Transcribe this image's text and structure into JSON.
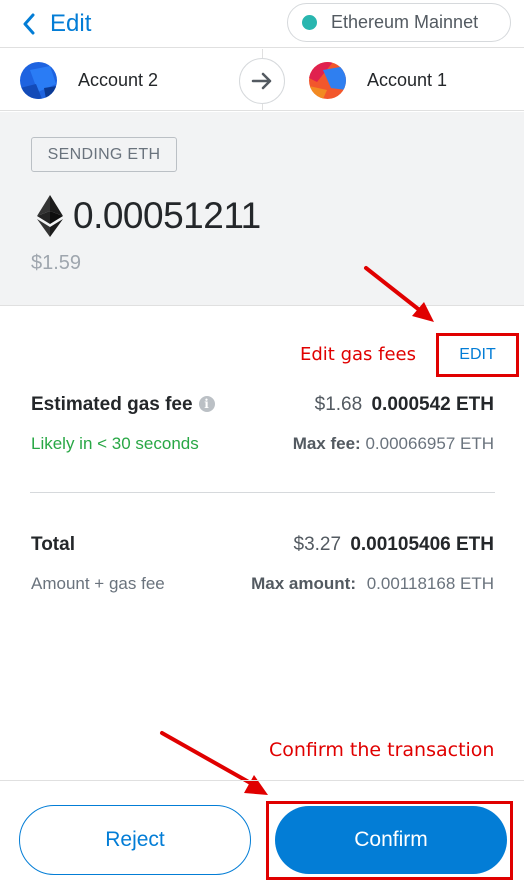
{
  "header": {
    "back_label": "Edit",
    "network": "Ethereum Mainnet",
    "network_color": "#29b6af"
  },
  "accounts": {
    "from": "Account 2",
    "to": "Account 1"
  },
  "sending": {
    "badge": "SENDING ETH",
    "amount": "0.00051211",
    "fiat": "$1.59"
  },
  "gas": {
    "annotation": "Edit gas fees",
    "edit_label": "EDIT",
    "label": "Estimated gas fee",
    "fiat": "$1.68",
    "eth": "0.000542 ETH",
    "timing": "Likely in < 30 seconds",
    "max_fee_label": "Max fee:",
    "max_fee_value": "0.00066957 ETH"
  },
  "total": {
    "label": "Total",
    "fiat": "$3.27",
    "eth": "0.00105406 ETH",
    "sub": "Amount + gas fee",
    "max_amount_label": "Max amount:",
    "max_amount_value": "0.00118168 ETH"
  },
  "footer": {
    "annotation": "Confirm the transaction",
    "reject_label": "Reject",
    "confirm_label": "Confirm"
  },
  "colors": {
    "accent": "#037dd6",
    "success": "#28a745",
    "annotation": "#e00000"
  }
}
